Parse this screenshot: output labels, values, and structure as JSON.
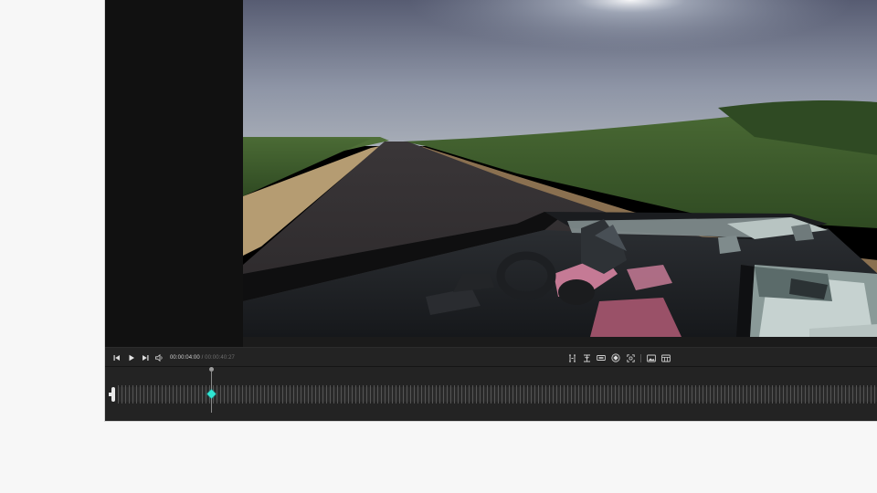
{
  "player": {
    "current_time": "00:00:04:00",
    "separator": "/",
    "duration": "00:00:40:27",
    "progress_fraction": 0.1
  },
  "controls": {
    "left": [
      "skip-back-icon",
      "play-icon",
      "skip-forward-icon",
      "volume-icon"
    ],
    "right": [
      "trim-in-icon",
      "trim-out-icon",
      "aspect-ratio-icon",
      "keyframe-icon",
      "reframe-icon",
      "snapshot-icon",
      "export-frame-icon"
    ]
  },
  "colors": {
    "keyframe_accent": "#2fe6d2",
    "panel_bg": "#1b1b1b",
    "page_bg": "#f7f7f7"
  }
}
